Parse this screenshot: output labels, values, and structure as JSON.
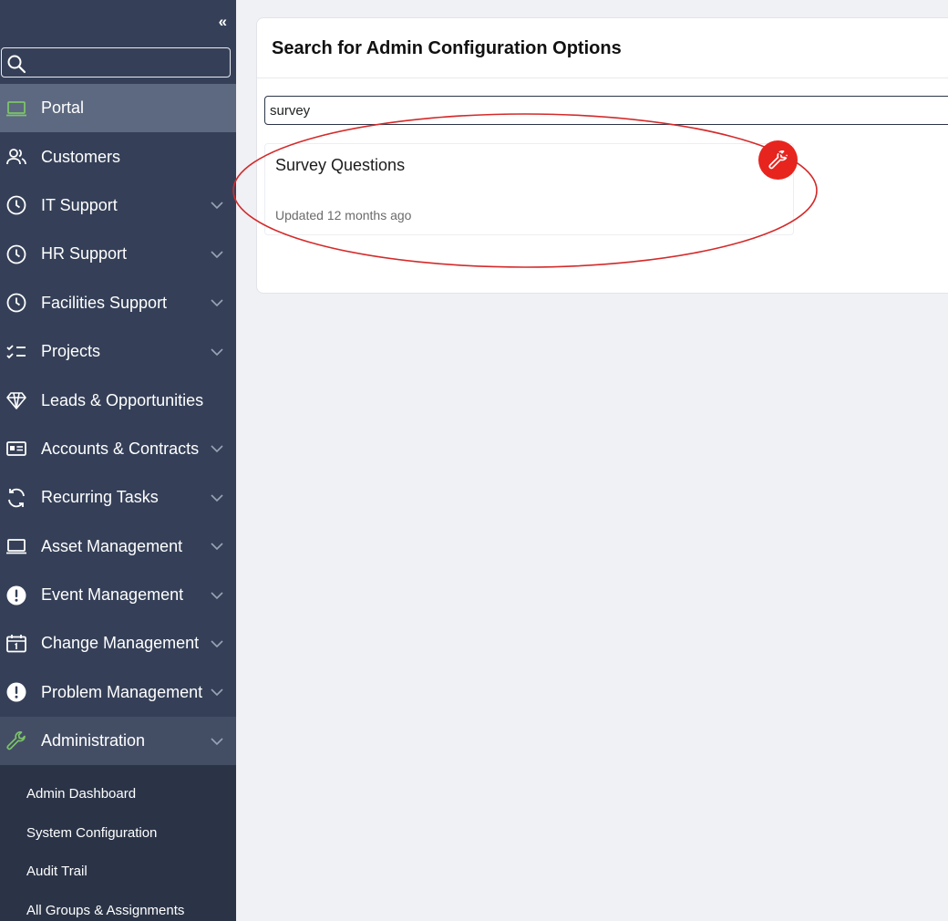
{
  "sidebar": {
    "collapse_label": "‹‹",
    "search": {
      "value": "",
      "placeholder": ""
    },
    "items": [
      {
        "label": "Portal",
        "icon": "laptop-icon",
        "active": true,
        "has_chevron": false
      },
      {
        "label": "Customers",
        "icon": "users-icon",
        "has_chevron": false
      },
      {
        "label": "IT Support",
        "icon": "clock-icon",
        "has_chevron": true
      },
      {
        "label": "HR Support",
        "icon": "clock-icon",
        "has_chevron": true
      },
      {
        "label": "Facilities Support",
        "icon": "clock-icon",
        "has_chevron": true
      },
      {
        "label": "Projects",
        "icon": "checklist-icon",
        "has_chevron": true
      },
      {
        "label": "Leads & Opportunities",
        "icon": "diamond-icon",
        "has_chevron": false
      },
      {
        "label": "Accounts & Contracts",
        "icon": "id-card-icon",
        "has_chevron": true
      },
      {
        "label": "Recurring Tasks",
        "icon": "refresh-icon",
        "has_chevron": true
      },
      {
        "label": "Asset Management",
        "icon": "laptop-icon",
        "has_chevron": true
      },
      {
        "label": "Event Management",
        "icon": "alert-icon",
        "has_chevron": true
      },
      {
        "label": "Change Management",
        "icon": "calendar-icon",
        "has_chevron": true
      },
      {
        "label": "Problem Management",
        "icon": "alert-icon",
        "has_chevron": true
      },
      {
        "label": "Administration",
        "icon": "wrench-icon",
        "has_chevron": true,
        "expanded": true
      }
    ],
    "sub_items": [
      {
        "label": "Admin Dashboard"
      },
      {
        "label": "System Configuration"
      },
      {
        "label": "Audit Trail"
      },
      {
        "label": "All Groups & Assignments"
      }
    ]
  },
  "main": {
    "title": "Search for Admin Configuration Options",
    "search": {
      "value": "survey",
      "placeholder": ""
    },
    "results": [
      {
        "title": "Survey Questions",
        "meta": "Updated 12 months ago",
        "icon": "wrench-icon"
      }
    ]
  },
  "colors": {
    "sidebar_bg": "#354058",
    "sidebar_active": "#5d6980",
    "sidebar_sub_bg": "#2b3447",
    "accent_green": "#7cc46a",
    "badge_red": "#e8241e",
    "highlight_red": "#d42a2a",
    "page_bg": "#f0f1f5"
  }
}
